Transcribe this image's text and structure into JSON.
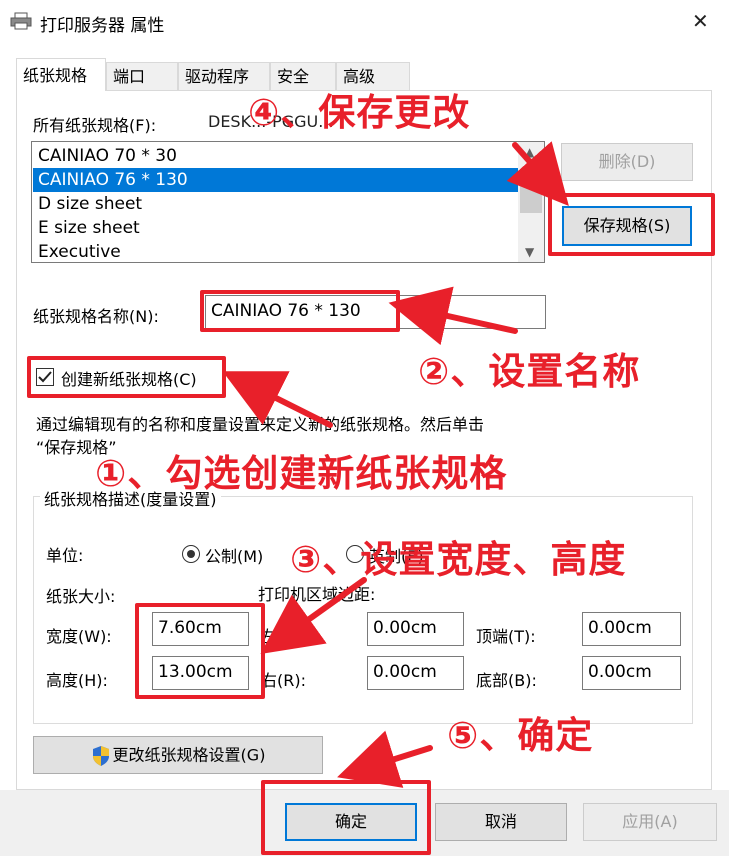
{
  "window": {
    "title": "打印服务器 属性",
    "close_symbol": "✕"
  },
  "tabs": [
    {
      "label": "纸张规格",
      "active": true
    },
    {
      "label": "端口"
    },
    {
      "label": "驱动程序"
    },
    {
      "label": "安全"
    },
    {
      "label": "高级"
    }
  ],
  "forms_section": {
    "label": "所有纸张规格(F):",
    "server_name": "DESK...-PGGU...",
    "list_items": [
      "CAINIAO 70 * 30",
      "CAINIAO 76 * 130",
      "D size sheet",
      "E size sheet",
      "Executive"
    ],
    "selected_index": 1,
    "delete_button": "删除(D)",
    "save_button": "保存规格(S)"
  },
  "form_name": {
    "label": "纸张规格名称(N):",
    "value": "CAINIAO 76 * 130"
  },
  "create_new": {
    "label": "创建新纸张规格(C)",
    "checked": true
  },
  "description": {
    "line1": "通过编辑现有的名称和度量设置来定义新的纸张规格。然后单击",
    "line2": "“保存规格”"
  },
  "measurements": {
    "group_title": "纸张规格描述(度量设置)",
    "unit_label": "单位:",
    "unit_metric": "公制(M)",
    "unit_english": "英制(E)",
    "paper_size_label": "纸张大小:",
    "margins_label": "打印机区域边距:",
    "width_label": "宽度(W):",
    "width_value": "7.60cm",
    "height_label": "高度(H):",
    "height_value": "13.00cm",
    "left_label": "左(L):",
    "left_value": "0.00cm",
    "right_label": "右(R):",
    "right_value": "0.00cm",
    "top_label": "顶端(T):",
    "top_value": "0.00cm",
    "bottom_label": "底部(B):",
    "bottom_value": "0.00cm"
  },
  "change_settings_button": "更改纸张规格设置(G)",
  "footer": {
    "ok": "确定",
    "cancel": "取消",
    "apply": "应用(A)"
  },
  "annotations": {
    "step1": "①、勾选创建新纸张规格",
    "step2": "②、设置名称",
    "step3": "③、设置宽度、高度",
    "step4": "④、保存更改",
    "step5": "⑤、确定",
    "color": "#e8202a"
  }
}
